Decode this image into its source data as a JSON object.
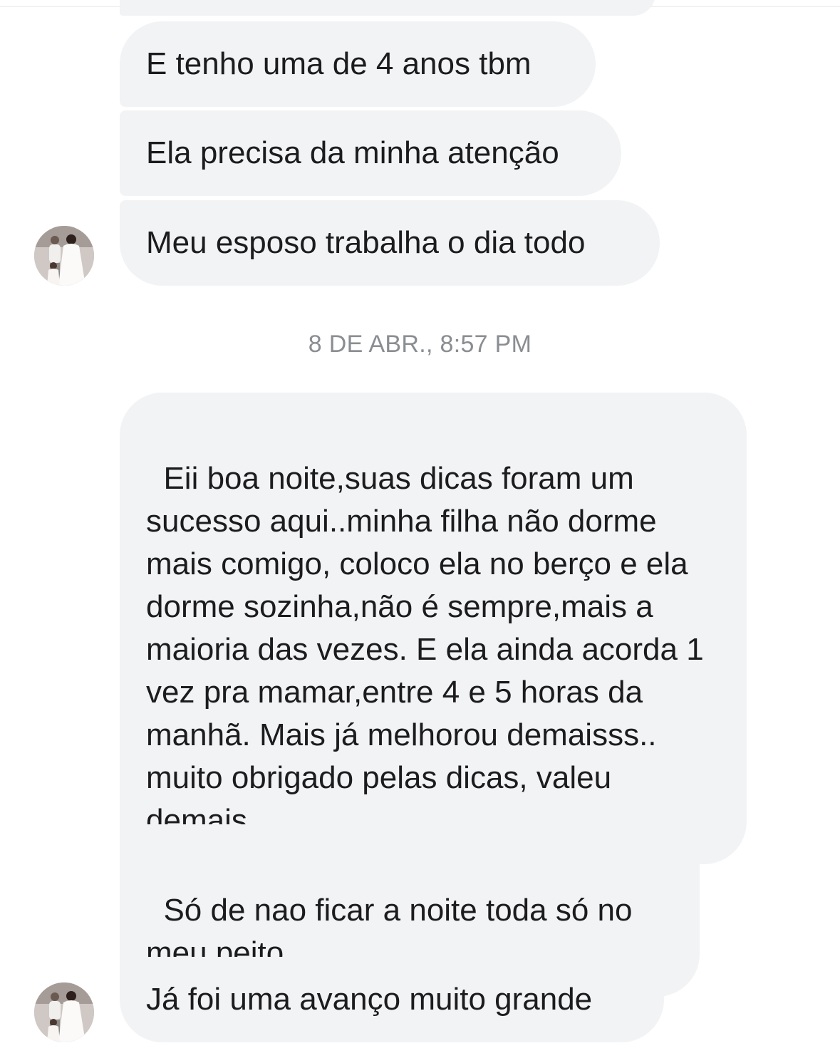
{
  "conversation": {
    "messages_before": [
      {
        "text": "E tenho uma de 4 anos tbm"
      },
      {
        "text": "Ela precisa da minha atenção"
      },
      {
        "text": "Meu esposo trabalha o dia todo"
      }
    ],
    "timestamp": "8 DE ABR., 8:57 PM",
    "messages_after": [
      {
        "text": "Eii boa noite,suas dicas foram um sucesso aqui..minha filha não dorme mais comigo, coloco ela no berço e ela dorme sozinha,não é sempre,mais a maioria das vezes. E ela ainda acorda 1 vez pra mamar,entre 4 e 5 horas da manhã. Mais já melhorou demaisss.. muito obrigado pelas dicas, valeu demais"
      },
      {
        "text": "Só de nao ficar a noite toda só no meu peito"
      },
      {
        "text": "Já foi uma avanço muito grande"
      }
    ]
  },
  "sender": {
    "avatar_icon": "family-photo-avatar-icon"
  },
  "colors": {
    "bubble_background": "#f2f3f5",
    "message_text": "#1c1c1e",
    "timestamp_text": "#8a8d91",
    "page_background": "#ffffff"
  }
}
